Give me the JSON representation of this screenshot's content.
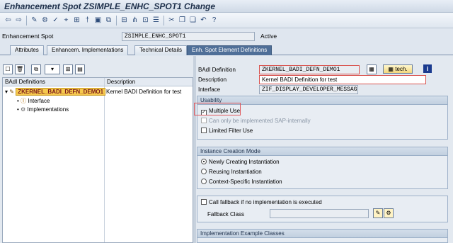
{
  "window": {
    "title": "Enhancement Spot ZSIMPLE_ENHC_SPOT1 Change"
  },
  "toolbar": {
    "icons": [
      "back-icon",
      "forward-icon",
      "display-change-icon",
      "activate-icon",
      "check-icon",
      "where-used-icon",
      "hierarchy-icon",
      "other-object-icon",
      "navigator-icon",
      "display-object-list-icon",
      "worklist-icon",
      "cut-icon",
      "copy-icon",
      "paste-icon",
      "undo-icon",
      "help-icon"
    ]
  },
  "header": {
    "spot_label": "Enhancement Spot",
    "spot_value": "ZSIMPLE_ENHC_SPOT1",
    "status": "Active"
  },
  "tabs": [
    "Attributes",
    "Enhancem. Implementations",
    "Technical Details",
    "Enh. Spot Element Definitions"
  ],
  "active_tab": "Enh. Spot Element Definitions",
  "tree": {
    "col_badi": "BAdI Definitions",
    "col_desc": "Description",
    "rows": [
      {
        "label": "ZKERNEL_BADI_DEFN_DEMO1",
        "desc": "Kernel BADI Definition for test"
      },
      {
        "label": "Interface",
        "desc": ""
      },
      {
        "label": "Implementations",
        "desc": ""
      }
    ]
  },
  "detail": {
    "badi_label": "BAdI Definition",
    "badi_value": "ZKERNEL_BADI_DEFN_DEMO1",
    "tech_button": "tech.",
    "desc_label": "Description",
    "desc_value": "Kernel BADI Definition for test",
    "iface_label": "Interface",
    "iface_value": "ZIF_DISPLAY_DEVELOPER_MESSAGE"
  },
  "usability": {
    "title": "Usability",
    "multiple_use": "Multiple Use",
    "sap_internal": "Can only be implemented SAP-internally",
    "limited_filter": "Limited Filter Use"
  },
  "instance": {
    "title": "Instance Creation Mode",
    "opt1": "Newly Creating Instantiation",
    "opt2": "Reusing Instantiation",
    "opt3": "Context-Specific Instantiation"
  },
  "fallback": {
    "check_label": "Call fallback if no implementation is executed",
    "class_label": "Fallback Class",
    "class_value": ""
  },
  "impl_example": {
    "title": "Implementation Example Classes"
  }
}
